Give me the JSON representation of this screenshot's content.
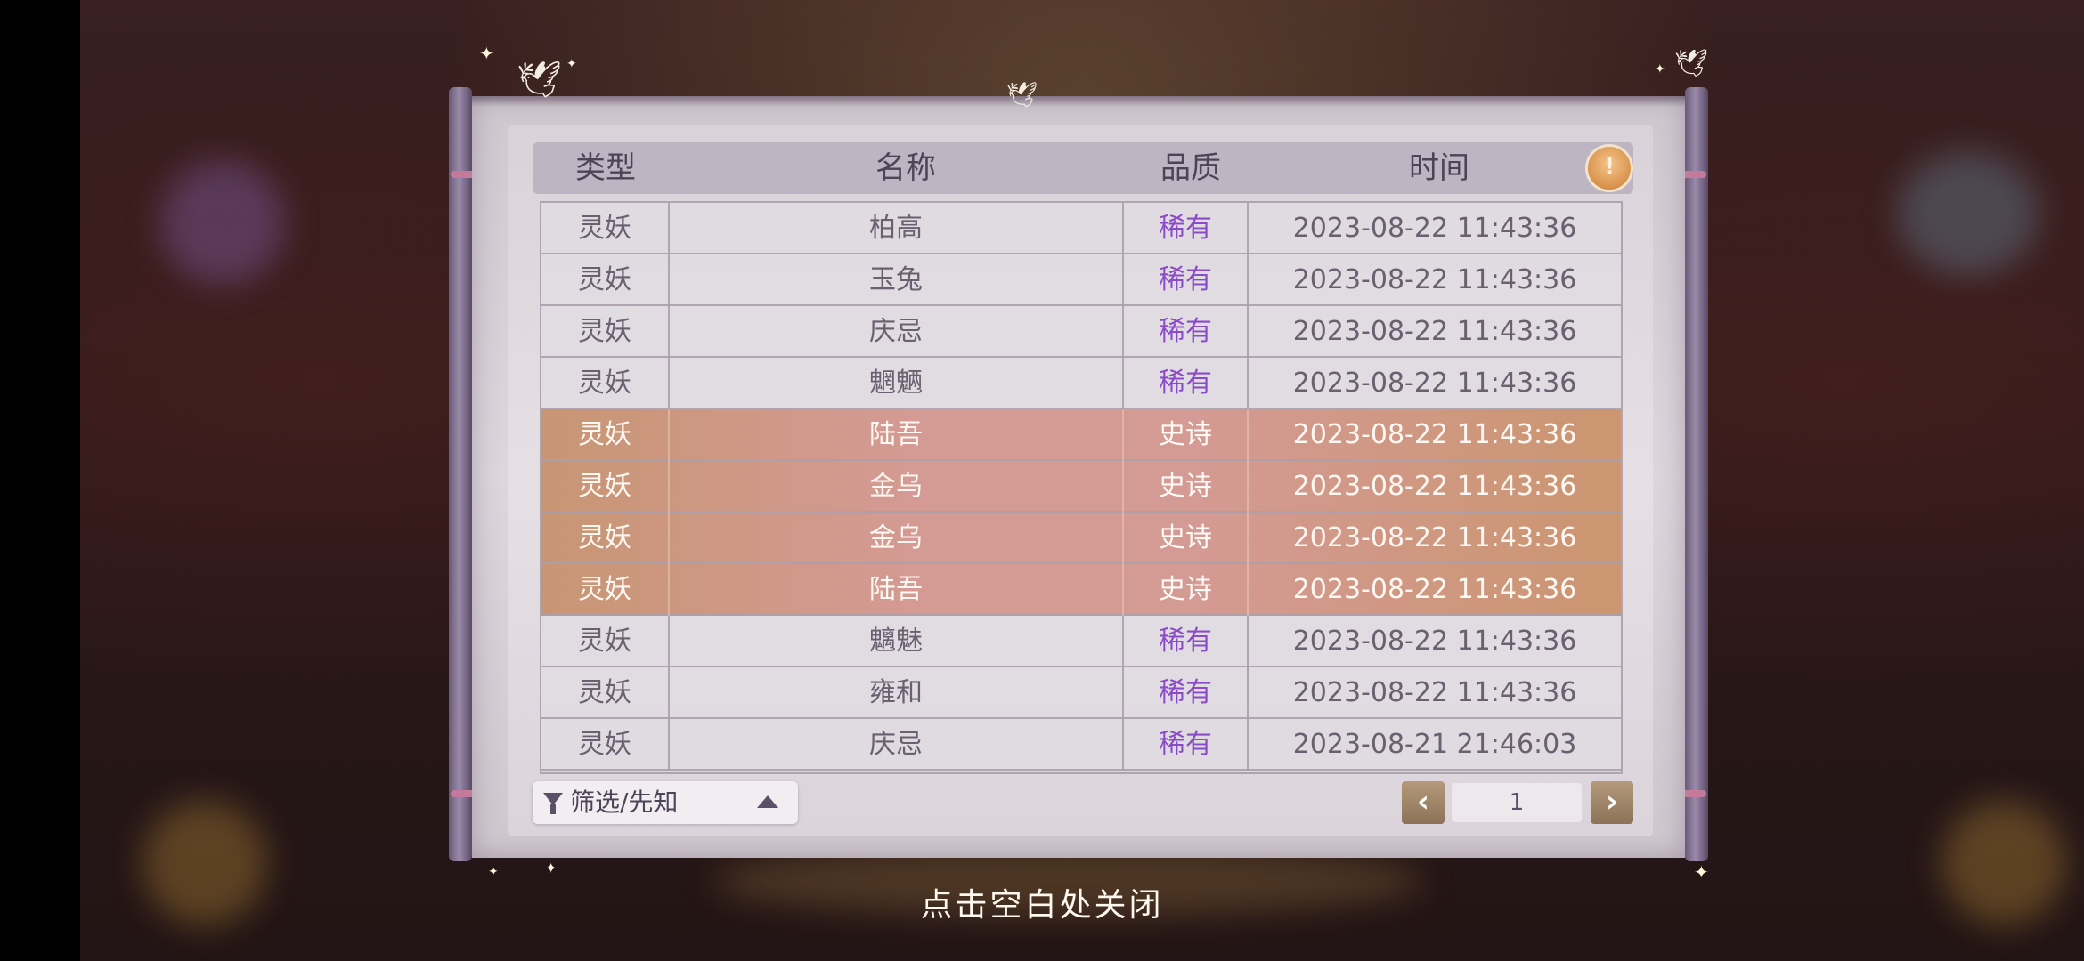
{
  "table": {
    "headers": [
      "类型",
      "名称",
      "品质",
      "时间"
    ],
    "rows": [
      {
        "type": "灵妖",
        "name": "柏高",
        "quality": "稀有",
        "time": "2023-08-22  11:43:36",
        "tier": "rare"
      },
      {
        "type": "灵妖",
        "name": "玉兔",
        "quality": "稀有",
        "time": "2023-08-22  11:43:36",
        "tier": "rare"
      },
      {
        "type": "灵妖",
        "name": "庆忌",
        "quality": "稀有",
        "time": "2023-08-22  11:43:36",
        "tier": "rare"
      },
      {
        "type": "灵妖",
        "name": "魍魉",
        "quality": "稀有",
        "time": "2023-08-22  11:43:36",
        "tier": "rare"
      },
      {
        "type": "灵妖",
        "name": "陆吾",
        "quality": "史诗",
        "time": "2023-08-22  11:43:36",
        "tier": "epic"
      },
      {
        "type": "灵妖",
        "name": "金乌",
        "quality": "史诗",
        "time": "2023-08-22  11:43:36",
        "tier": "epic"
      },
      {
        "type": "灵妖",
        "name": "金乌",
        "quality": "史诗",
        "time": "2023-08-22  11:43:36",
        "tier": "epic"
      },
      {
        "type": "灵妖",
        "name": "陆吾",
        "quality": "史诗",
        "time": "2023-08-22  11:43:36",
        "tier": "epic"
      },
      {
        "type": "灵妖",
        "name": "魑魅",
        "quality": "稀有",
        "time": "2023-08-22  11:43:36",
        "tier": "rare"
      },
      {
        "type": "灵妖",
        "name": "雍和",
        "quality": "稀有",
        "time": "2023-08-22  11:43:36",
        "tier": "rare"
      },
      {
        "type": "灵妖",
        "name": "庆忌",
        "quality": "稀有",
        "time": "2023-08-21  21:46:03",
        "tier": "rare"
      }
    ]
  },
  "filter": {
    "label": "筛选/先知"
  },
  "pagination": {
    "page": "1",
    "prev_icon": "chevron-left-icon",
    "next_icon": "chevron-right-icon"
  },
  "tip_icon": "lightbulb-icon",
  "close_hint": "点击空白处关闭",
  "colors": {
    "rare_text": "#8a4bc8",
    "epic_row": "#d49a94",
    "header_text": "#4e4458"
  }
}
